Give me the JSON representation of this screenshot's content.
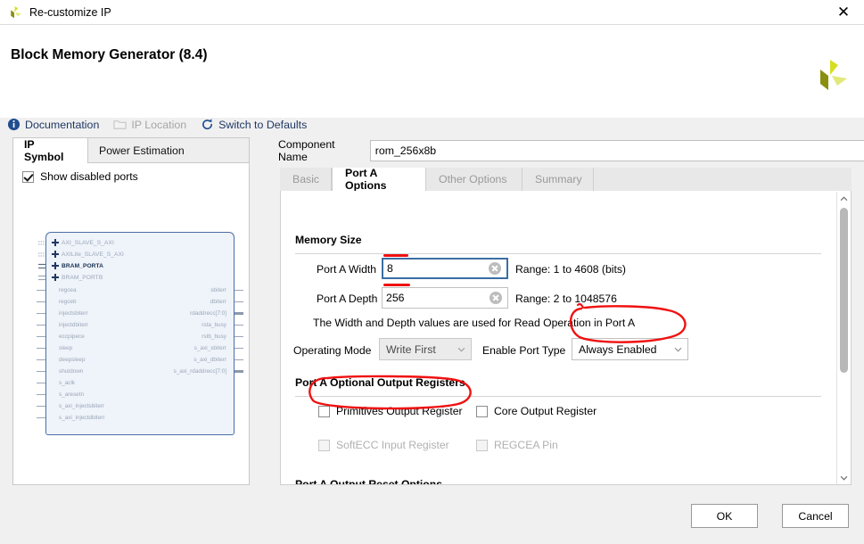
{
  "titlebar": {
    "title": "Re-customize IP",
    "close_icon": "close-icon",
    "logo_icon": "xilinx-logo-icon"
  },
  "header": {
    "title": "Block Memory Generator (8.4)",
    "logo_icon": "xilinx-logo-icon",
    "toolbar": [
      {
        "label": "Documentation",
        "icon": "info-icon",
        "disabled": false
      },
      {
        "label": "IP Location",
        "icon": "folder-icon",
        "disabled": true
      },
      {
        "label": "Switch to Defaults",
        "icon": "refresh-icon",
        "disabled": false
      }
    ]
  },
  "left_panel": {
    "tabs": [
      {
        "label": "IP Symbol",
        "active": true
      },
      {
        "label": "Power Estimation",
        "active": false
      }
    ],
    "show_disabled_ports": {
      "label": "Show disabled ports",
      "checked": true
    },
    "symbol": {
      "interfaces": [
        {
          "name": "AXI_SLAVE_S_AXI",
          "enabled": false
        },
        {
          "name": "AXILite_SLAVE_S_AXI",
          "enabled": false
        },
        {
          "name": "BRAM_PORTA",
          "enabled": true
        },
        {
          "name": "BRAM_PORTB",
          "enabled": false
        }
      ],
      "left_ports": [
        "regcea",
        "regceb",
        "injectsbiterr",
        "injectdbiterr",
        "eccpipece",
        "sleep",
        "deepsleep",
        "shutdown",
        "s_aclk",
        "s_aresetn",
        "s_axi_injectsbiterr",
        "s_axi_injectdbiterr"
      ],
      "right_ports": [
        "sbiterr",
        "dbiterr",
        "rdaddrecc[7:0]",
        "rsta_busy",
        "rstb_busy",
        "s_axi_sbiterr",
        "s_axi_dbiterr",
        "s_axi_rdaddrecc[7:0]"
      ]
    }
  },
  "main": {
    "component_name": {
      "label": "Component Name",
      "value": "rom_256x8b"
    },
    "tabs": [
      {
        "label": "Basic",
        "active": false
      },
      {
        "label": "Port A Options",
        "active": true
      },
      {
        "label": "Other Options",
        "active": false
      },
      {
        "label": "Summary",
        "active": false
      }
    ],
    "memory_size": {
      "section_title": "Memory Size",
      "port_a_width": {
        "label": "Port A Width",
        "value": "8",
        "range": "Range: 1 to 4608 (bits)"
      },
      "port_a_depth": {
        "label": "Port A Depth",
        "value": "256",
        "range": "Range: 2 to 1048576"
      },
      "note": "The Width and Depth values are used for Read Operation in Port A",
      "operating_mode": {
        "label": "Operating Mode",
        "value": "Write First",
        "disabled": true
      },
      "enable_port_type": {
        "label": "Enable Port Type",
        "value": "Always Enabled",
        "disabled": false
      }
    },
    "optional_output_registers": {
      "section_title": "Port A Optional Output Registers",
      "checkboxes": [
        {
          "label": "Primitives Output Register",
          "checked": false,
          "disabled": false
        },
        {
          "label": "Core Output Register",
          "checked": false,
          "disabled": false
        },
        {
          "label": "SoftECC Input Register",
          "checked": false,
          "disabled": true
        },
        {
          "label": "REGCEA Pin",
          "checked": false,
          "disabled": true
        }
      ]
    },
    "output_reset_options": {
      "section_title": "Port A Output Reset Options"
    },
    "scrollbar": {
      "up_icon": "chevron-up-icon",
      "down_icon": "chevron-down-icon"
    }
  },
  "footer": {
    "ok": "OK",
    "cancel": "Cancel"
  },
  "annotations": {
    "color": "#f01010"
  },
  "colors": {
    "accent_blue": "#1f3864",
    "focus_border": "#3b6ea5",
    "symbol_fill": "#eff3fa",
    "symbol_border": "#4a6fa5",
    "annotation_red": "#f01010"
  }
}
